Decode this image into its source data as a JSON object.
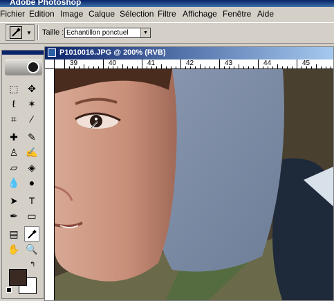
{
  "app": {
    "title": "Adobe Photoshop"
  },
  "menu": [
    "Fichier",
    "Edition",
    "Image",
    "Calque",
    "Sélection",
    "Filtre",
    "Affichage",
    "Fenêtre",
    "Aide"
  ],
  "options": {
    "tool_icon": "eyedropper-icon",
    "taille_label": "Taille :",
    "sample_size_value": "Echantillon ponctuel"
  },
  "document": {
    "title": "P1010016.JPG @ 200% (RVB)",
    "ruler_labels": [
      "39",
      "40",
      "41",
      "42",
      "43",
      "44",
      "45"
    ]
  },
  "tools": [
    "marquee-icon",
    "move-icon",
    "lasso-icon",
    "magic-wand-icon",
    "crop-icon",
    "slice-icon",
    "healing-brush-icon",
    "brush-icon",
    "clone-stamp-icon",
    "history-brush-icon",
    "eraser-icon",
    "paint-bucket-icon",
    "blur-icon",
    "dodge-icon",
    "path-selection-icon",
    "type-icon",
    "pen-icon",
    "rectangle-icon",
    "notes-icon",
    "eyedropper-icon",
    "hand-icon",
    "zoom-icon"
  ],
  "colors": {
    "foreground": "#3a2a22",
    "background": "#ffffff",
    "title_bar": "#0a246a"
  }
}
